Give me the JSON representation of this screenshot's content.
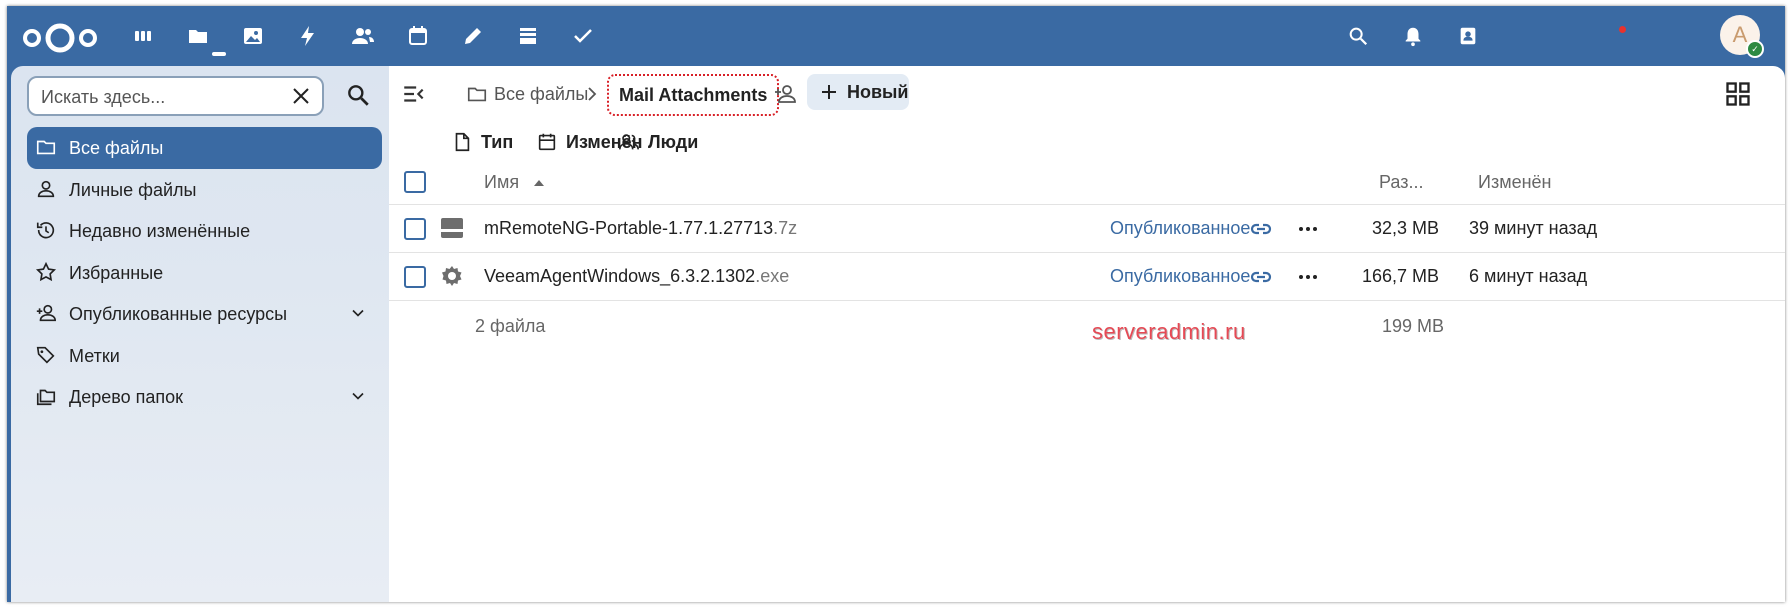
{
  "topbar": {
    "logo": "nextcloud-logo",
    "apps": [
      "dashboard-icon",
      "files-icon",
      "photos-icon",
      "activity-icon",
      "contacts-icon",
      "calendar-icon",
      "notes-icon",
      "deck-icon",
      "tasks-icon"
    ],
    "active_app": "files-icon",
    "right_icons": [
      "search-icon",
      "bell-icon",
      "contacts-menu-icon"
    ],
    "avatar_letter": "A",
    "notification_color": "#e9322d",
    "status_color": "#2d8a43"
  },
  "sidebar": {
    "search_placeholder": "Искать здесь...",
    "items": [
      {
        "label": "Все файлы",
        "icon": "folder-icon",
        "active": true
      },
      {
        "label": "Личные файлы",
        "icon": "user-icon"
      },
      {
        "label": "Недавно изменённые",
        "icon": "history-icon"
      },
      {
        "label": "Избранные",
        "icon": "star-icon"
      },
      {
        "label": "Опубликованные ресурсы",
        "icon": "share-user-icon",
        "expandable": true
      },
      {
        "label": "Метки",
        "icon": "tags-icon"
      },
      {
        "label": "Дерево папок",
        "icon": "folders-icon",
        "expandable": true
      }
    ]
  },
  "breadcrumb": {
    "root": "Все файлы",
    "current": "Mail Attachments"
  },
  "new_button": "Новый",
  "filters": [
    "Тип",
    "Изменён",
    "Люди"
  ],
  "table": {
    "columns": {
      "name": "Имя",
      "size": "Раз...",
      "modified": "Изменён"
    },
    "sort": "name-asc",
    "rows": [
      {
        "basename": "mRemoteNG-Portable-1.77.1.27713",
        "ext": ".7z",
        "type_icon": "archive-icon",
        "shared": "Опубликованное",
        "size": "32,3 MB",
        "modified": "39 минут назад"
      },
      {
        "basename": "VeeamAgentWindows_6.3.2.1302",
        "ext": ".exe",
        "type_icon": "gear-icon",
        "shared": "Опубликованное",
        "size": "166,7 MB",
        "modified": "6 минут назад"
      }
    ],
    "summary": {
      "count": "2 файла",
      "total_size": "199 MB"
    }
  },
  "watermark": "serveradmin.ru",
  "colors": {
    "accent": "#3a6aa3",
    "highlight_border": "#d81f26"
  }
}
